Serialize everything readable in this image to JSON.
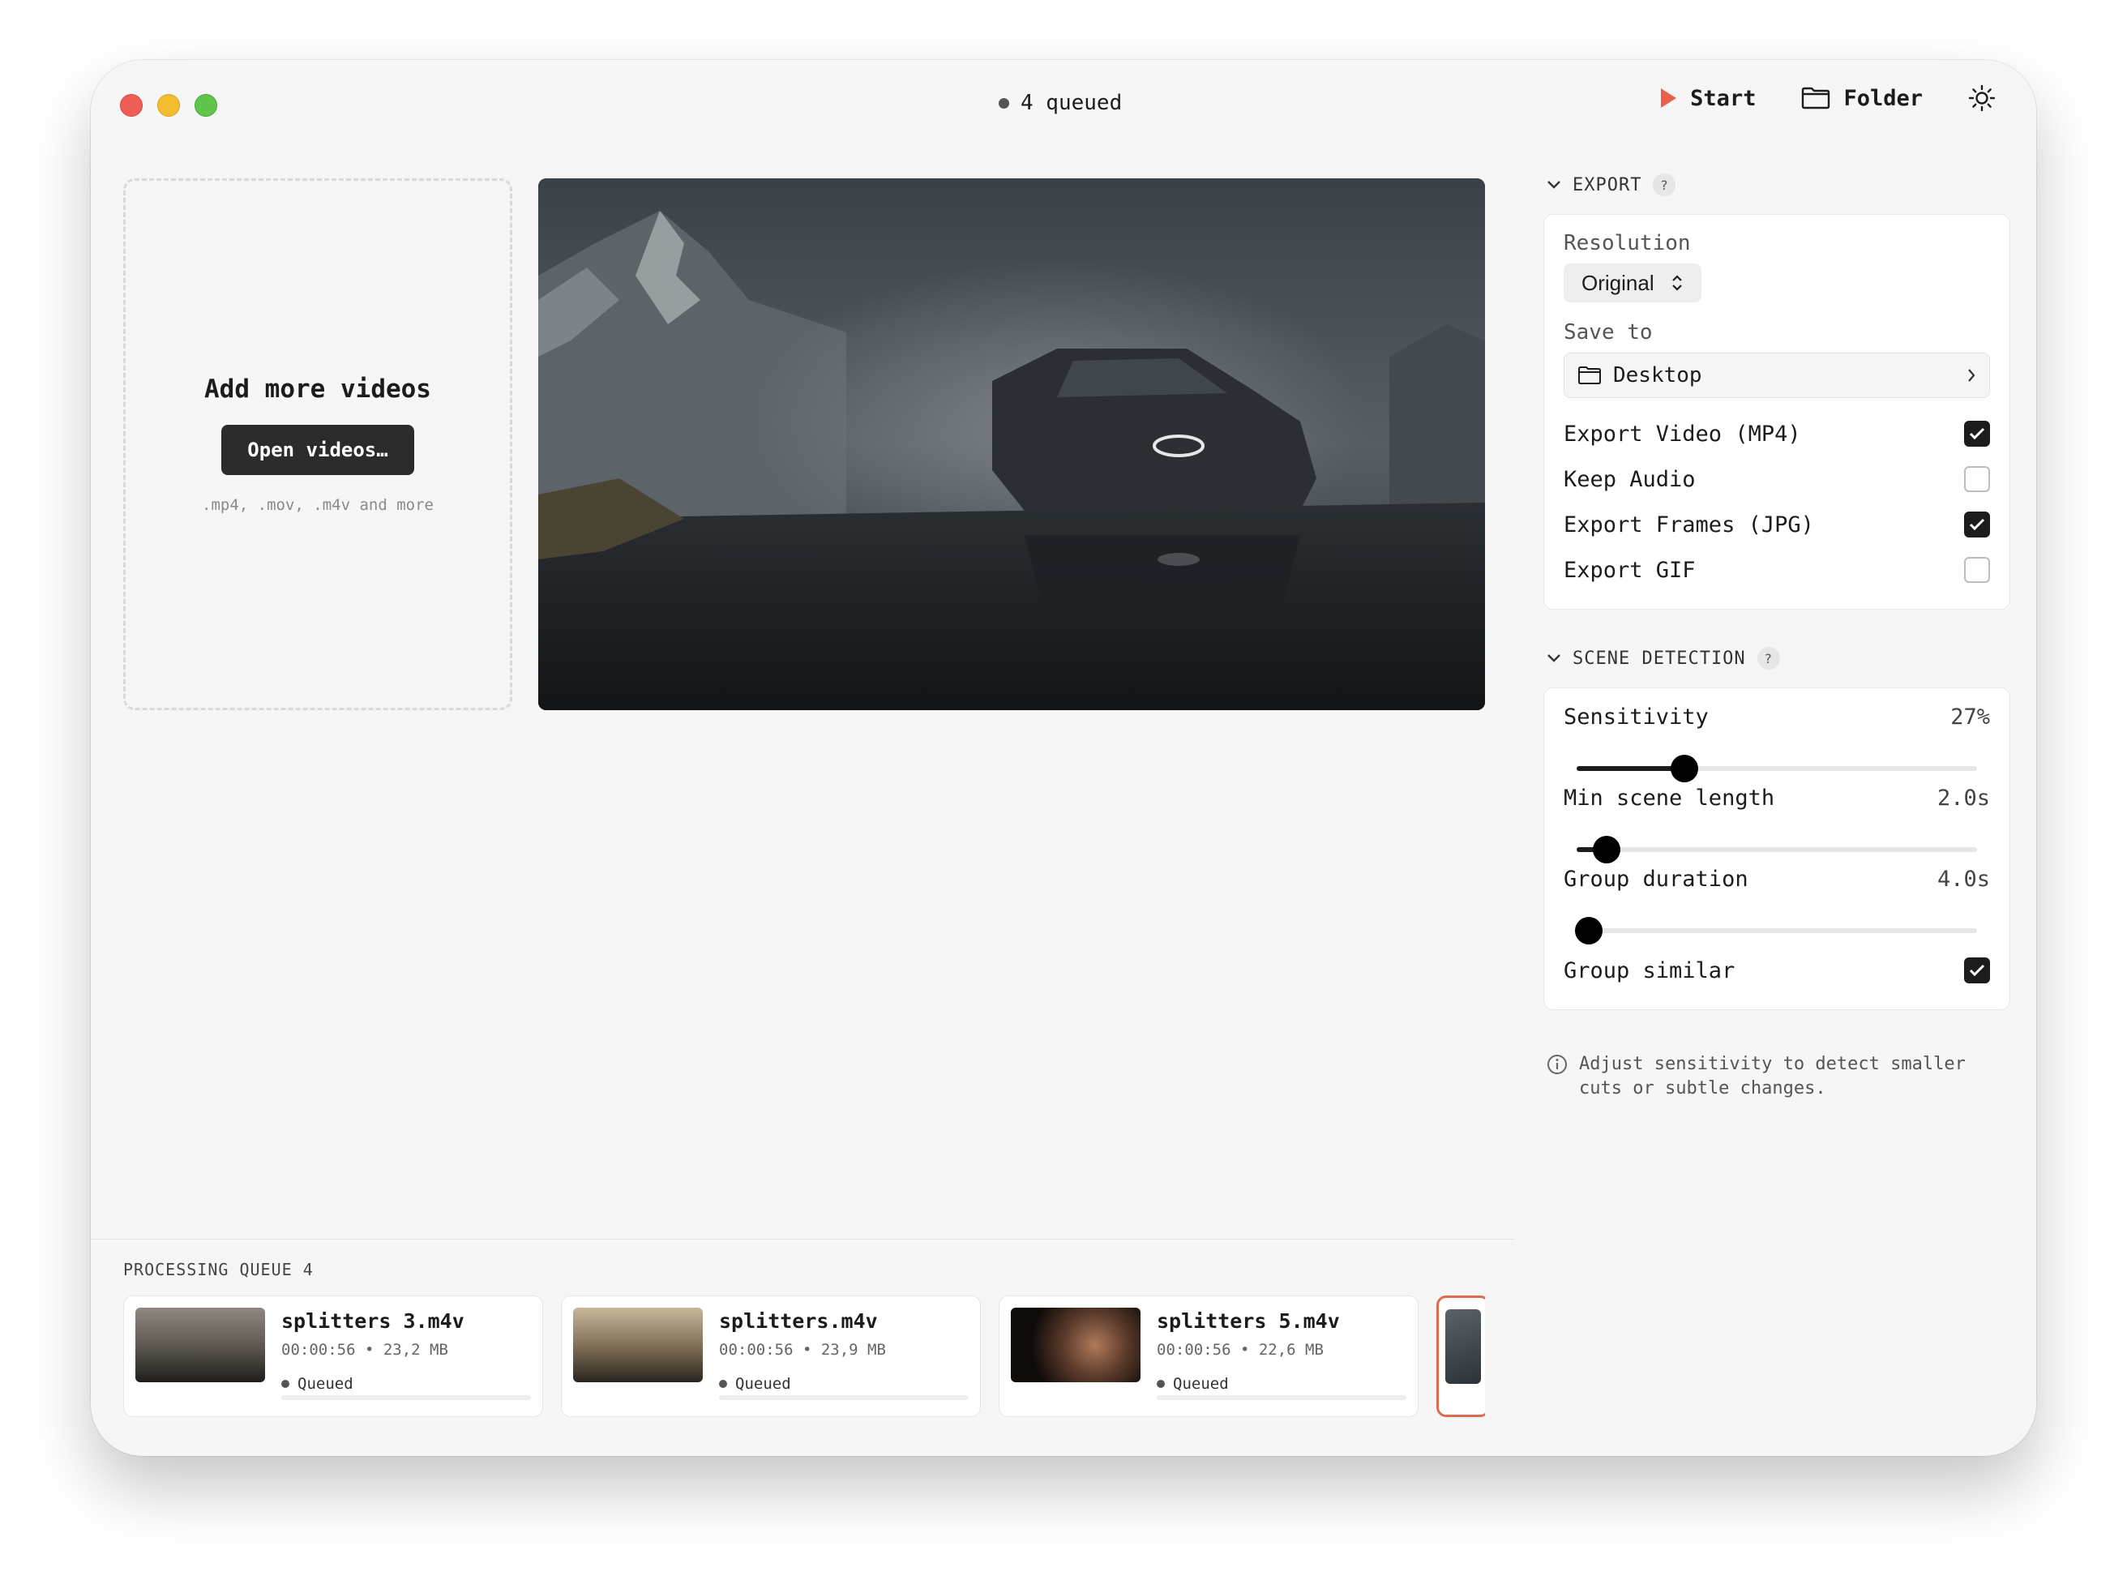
{
  "status": {
    "text": "4 queued"
  },
  "toolbar": {
    "start_label": "Start",
    "folder_label": "Folder",
    "icons": {
      "start": "play-icon",
      "folder": "folder-icon",
      "theme": "sun-icon"
    }
  },
  "dropzone": {
    "title": "Add more videos",
    "button_label": "Open videos…",
    "hint": ".mp4, .mov, .m4v and more"
  },
  "export": {
    "heading": "EXPORT",
    "help": "?",
    "resolution_label": "Resolution",
    "resolution_value": "Original",
    "save_to_label": "Save to",
    "save_to_value": "Desktop",
    "options": [
      {
        "label": "Export Video (MP4)",
        "checked": true
      },
      {
        "label": "Keep Audio",
        "checked": false
      },
      {
        "label": "Export Frames (JPG)",
        "checked": true
      },
      {
        "label": "Export GIF",
        "checked": false
      }
    ]
  },
  "scene": {
    "heading": "SCENE DETECTION",
    "help": "?",
    "sliders": [
      {
        "label": "Sensitivity",
        "value": "27%",
        "fraction": 0.27
      },
      {
        "label": "Min scene length",
        "value": "2.0s",
        "fraction": 0.075
      },
      {
        "label": "Group duration",
        "value": "4.0s",
        "fraction": 0.03
      }
    ],
    "group_similar": {
      "label": "Group similar",
      "checked": true
    }
  },
  "info_text": "Adjust sensitivity to detect smaller cuts or subtle changes.",
  "queue": {
    "title": "PROCESSING QUEUE 4",
    "items": [
      {
        "name": "splitters 3.m4v",
        "meta": "00:00:56 • 23,2 MB",
        "status": "Queued"
      },
      {
        "name": "splitters.m4v",
        "meta": "00:00:56 • 23,9 MB",
        "status": "Queued"
      },
      {
        "name": "splitters 5.m4v",
        "meta": "00:00:56 • 22,6 MB",
        "status": "Queued"
      }
    ]
  },
  "colors": {
    "accent": "#e06a4d",
    "primary": "#1c1c1c",
    "start_icon": "#e8624b"
  }
}
